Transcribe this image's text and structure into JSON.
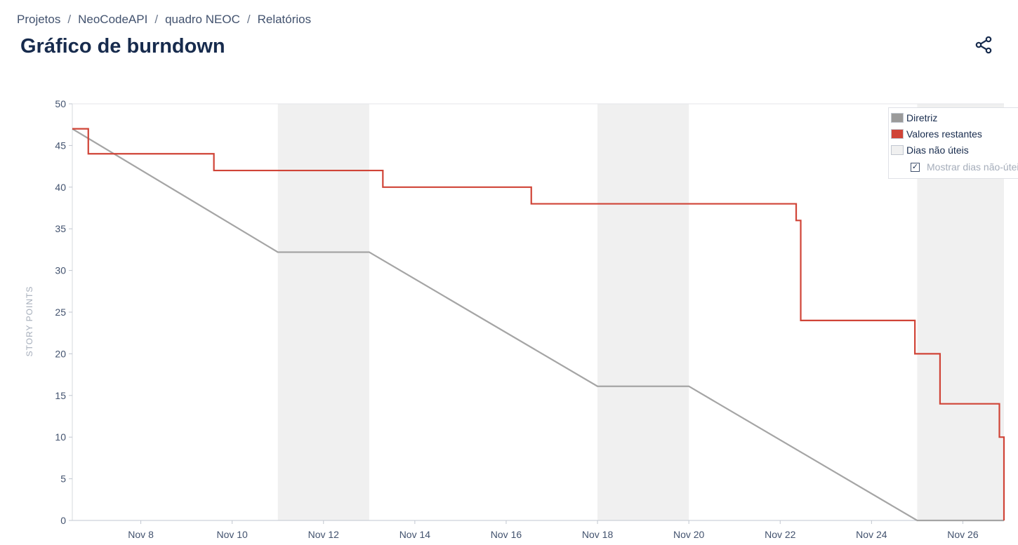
{
  "breadcrumb": {
    "items": [
      "Projetos",
      "NeoCodeAPI",
      "quadro NEOC",
      "Relatórios"
    ],
    "separator": "/"
  },
  "page": {
    "title": "Gráfico de burndown"
  },
  "toolbar": {
    "share_icon": "share-icon"
  },
  "legend": {
    "guideline": "Diretriz",
    "remaining": "Valores restantes",
    "non_working": "Dias não úteis",
    "show_non_working": "Mostrar dias não-úteis",
    "show_non_working_checked": true
  },
  "colors": {
    "guideline": "#a5a5a5",
    "remaining": "#d04437",
    "non_working": "#f0f0f0",
    "axis_text": "#42526e",
    "ylabel": "#a5adba"
  },
  "chart_data": {
    "type": "line",
    "title": "",
    "xlabel": "",
    "ylabel": "STORY POINTS",
    "x_unit": "day of November",
    "xlim": [
      6.5,
      26.9
    ],
    "ylim": [
      0,
      50
    ],
    "yticks": [
      0,
      5,
      10,
      15,
      20,
      25,
      30,
      35,
      40,
      45,
      50
    ],
    "xticks": [
      8,
      10,
      12,
      14,
      16,
      18,
      20,
      22,
      24,
      26
    ],
    "xtick_labels": [
      "Nov 8",
      "Nov 10",
      "Nov 12",
      "Nov 14",
      "Nov 16",
      "Nov 18",
      "Nov 20",
      "Nov 22",
      "Nov 24",
      "Nov 26"
    ],
    "grid": false,
    "legend_position": "top-right",
    "non_working_days": [
      [
        11,
        13
      ],
      [
        18,
        20
      ],
      [
        25,
        27
      ]
    ],
    "series": [
      {
        "name": "Diretriz",
        "step": false,
        "x": [
          6.5,
          11,
          13,
          18,
          20,
          25,
          26.9
        ],
        "y": [
          47,
          32.2,
          32.2,
          16.1,
          16.1,
          0,
          0
        ]
      },
      {
        "name": "Valores restantes",
        "step": true,
        "x": [
          6.5,
          6.85,
          9.6,
          13.3,
          16.55,
          22.35,
          22.45,
          24.95,
          25.5,
          26.8,
          26.9
        ],
        "y": [
          47,
          44,
          42,
          40,
          38,
          36,
          24,
          20,
          14,
          10,
          0
        ]
      }
    ]
  }
}
